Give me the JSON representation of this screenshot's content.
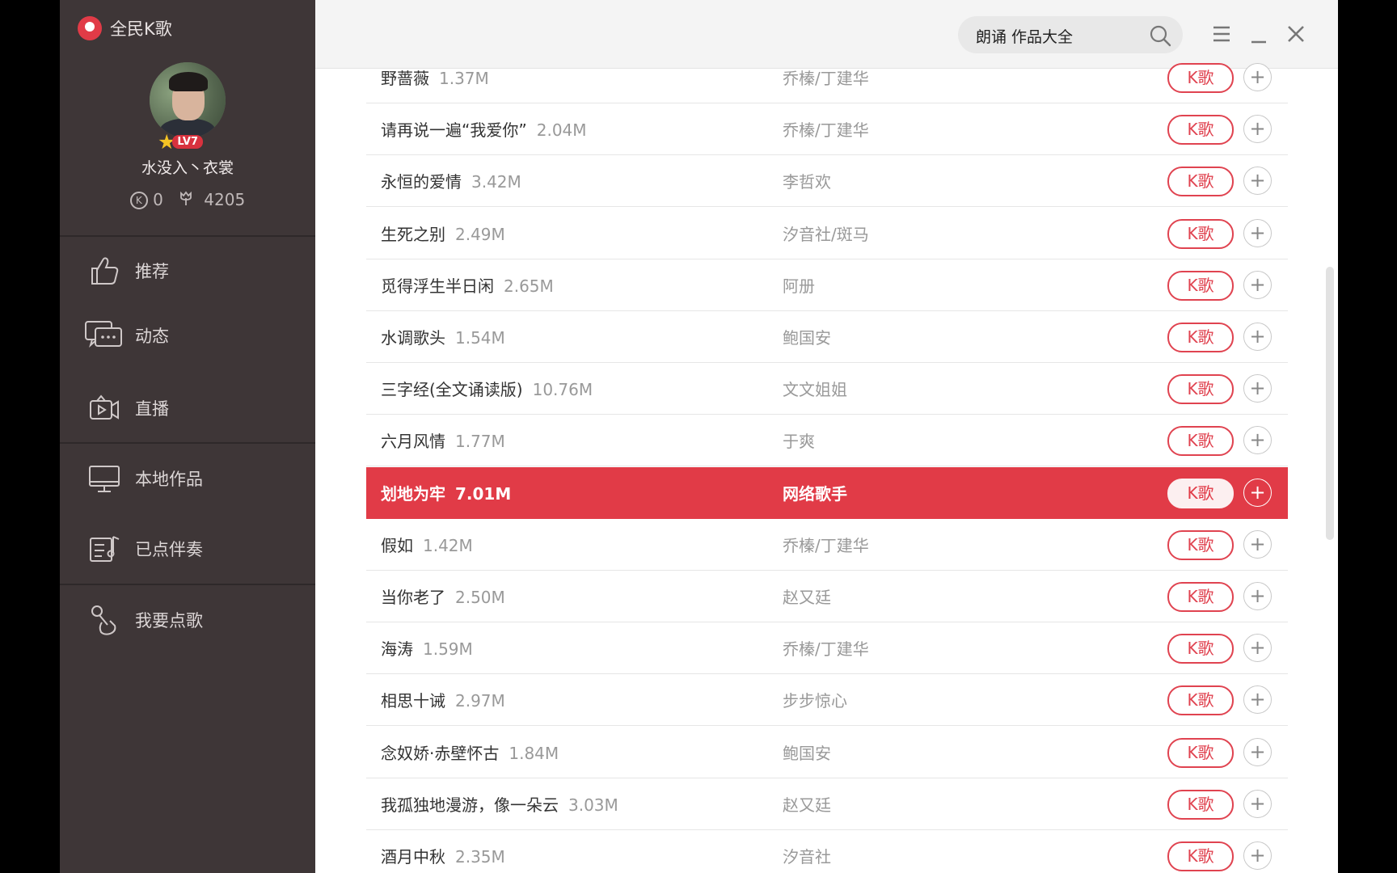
{
  "app": {
    "name": "全民K歌"
  },
  "user": {
    "name": "水没入丶衣裳",
    "level": "LV7",
    "coins": "0",
    "flowers": "4205"
  },
  "nav": [
    {
      "label": "推荐",
      "icon": "thumbs-up-icon"
    },
    {
      "label": "动态",
      "icon": "chat-bubbles-icon"
    },
    {
      "label": "直播",
      "icon": "live-video-icon"
    },
    {
      "label": "本地作品",
      "icon": "monitor-icon"
    },
    {
      "label": "已点伴奏",
      "icon": "music-list-icon"
    },
    {
      "label": "我要点歌",
      "icon": "microphone-hand-icon"
    }
  ],
  "search": {
    "value": "朗诵 作品大全",
    "placeholder": ""
  },
  "colors": {
    "accent": "#e13b47",
    "sidebar_bg": "#3e3637"
  },
  "songs": [
    {
      "title": "野蔷薇",
      "size": "1.37M",
      "artist": "乔榛/丁建华"
    },
    {
      "title": "请再说一遍“我爱你”",
      "size": "2.04M",
      "artist": "乔榛/丁建华"
    },
    {
      "title": "永恒的爱情",
      "size": "3.42M",
      "artist": "李哲欢"
    },
    {
      "title": "生死之别",
      "size": "2.49M",
      "artist": "汐音社/斑马"
    },
    {
      "title": "觅得浮生半日闲",
      "size": "2.65M",
      "artist": "阿册"
    },
    {
      "title": "水调歌头",
      "size": "1.54M",
      "artist": "鲍国安"
    },
    {
      "title": "三字经(全文诵读版)",
      "size": "10.76M",
      "artist": "文文姐姐"
    },
    {
      "title": "六月风情",
      "size": "1.77M",
      "artist": "于爽"
    },
    {
      "title": "划地为牢",
      "size": "7.01M",
      "artist": "网络歌手",
      "active": true
    },
    {
      "title": "假如",
      "size": "1.42M",
      "artist": "乔榛/丁建华"
    },
    {
      "title": "当你老了",
      "size": "2.50M",
      "artist": "赵又廷"
    },
    {
      "title": "海涛",
      "size": "1.59M",
      "artist": "乔榛/丁建华"
    },
    {
      "title": "相思十诫",
      "size": "2.97M",
      "artist": "步步惊心"
    },
    {
      "title": "念奴娇·赤壁怀古",
      "size": "1.84M",
      "artist": "鲍国安"
    },
    {
      "title": "我孤独地漫游，像一朵云",
      "size": "3.03M",
      "artist": "赵又廷"
    },
    {
      "title": "酒月中秋",
      "size": "2.35M",
      "artist": "汐音社"
    }
  ],
  "row_labels": {
    "k_button": "K歌",
    "add_button": "+"
  }
}
